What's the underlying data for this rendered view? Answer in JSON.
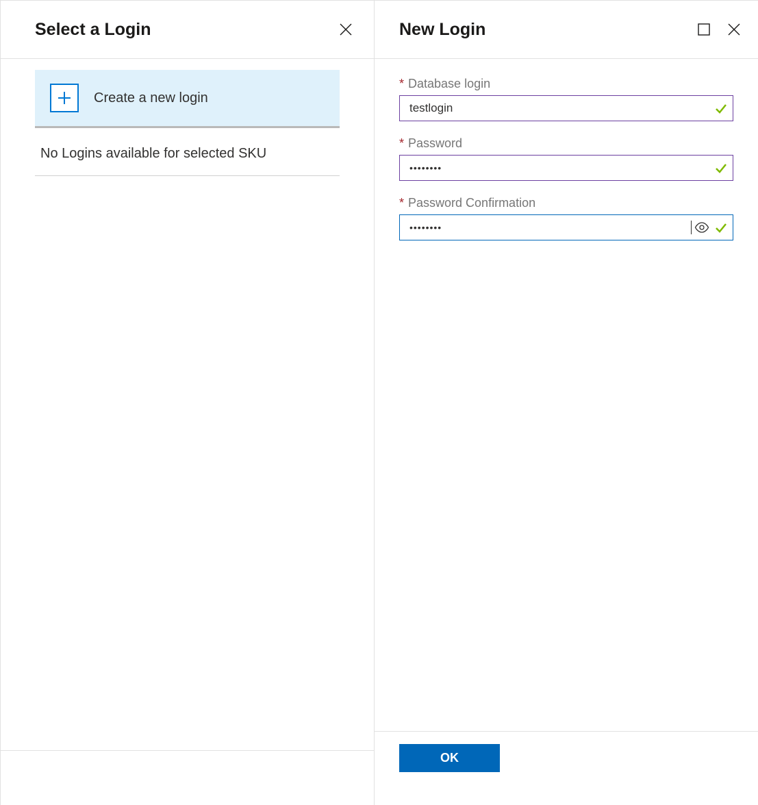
{
  "left": {
    "title": "Select a Login",
    "create_label": "Create a new login",
    "empty_message": "No Logins available for selected SKU"
  },
  "right": {
    "title": "New Login",
    "fields": {
      "db_login": {
        "label": "Database login",
        "value": "testlogin",
        "required": true
      },
      "password": {
        "label": "Password",
        "value": "••••••••",
        "required": true
      },
      "password_confirm": {
        "label": "Password Confirmation",
        "value": "••••••••",
        "required": true
      }
    },
    "ok_label": "OK"
  },
  "colors": {
    "accent_blue": "#0067b8",
    "purple_border": "#6b3fa0",
    "selected_bg": "#dff1fb",
    "check_green": "#7fba00",
    "required_red": "#a4262c"
  }
}
